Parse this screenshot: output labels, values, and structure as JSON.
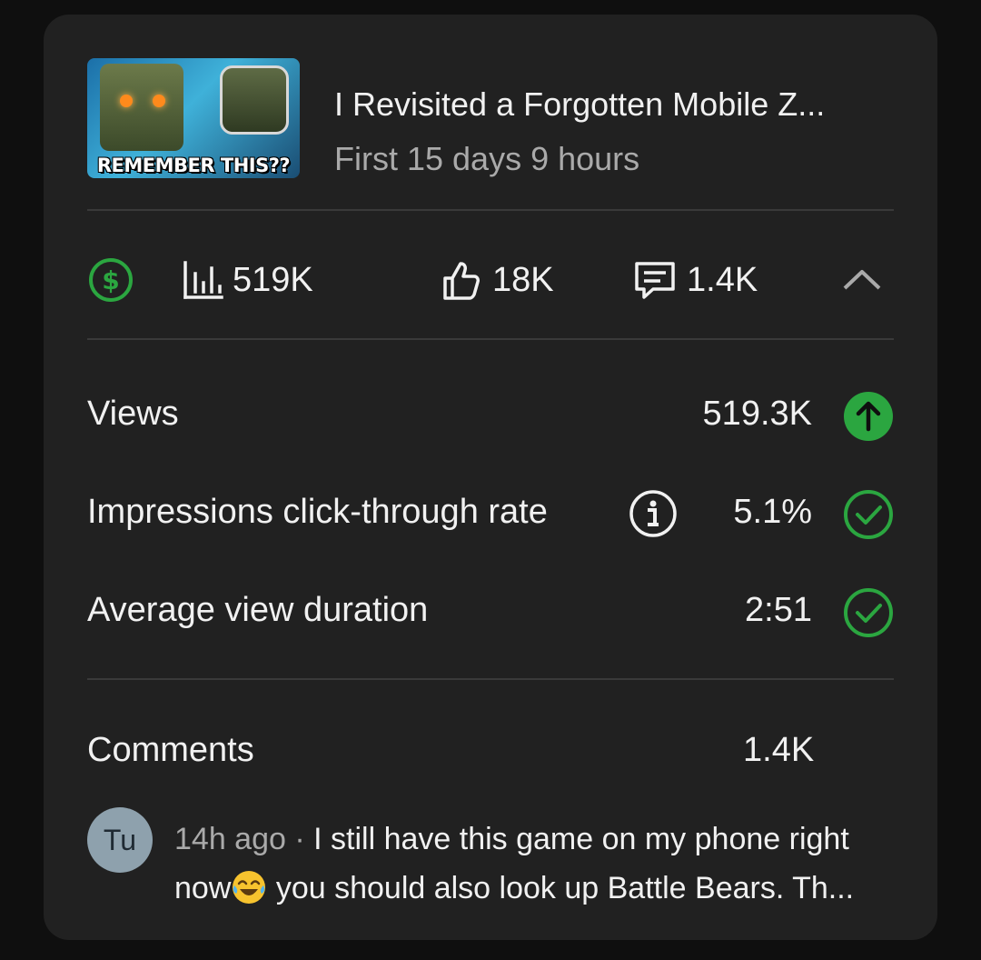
{
  "video": {
    "thumbnail_caption": "REMEMBER THIS??",
    "title": "I Revisited a Forgotten Mobile Z...",
    "subtitle": "First 15 days 9 hours"
  },
  "stats_bar": {
    "monetization_icon": "dollar-icon",
    "views": "519K",
    "likes": "18K",
    "comments": "1.4K",
    "collapse_icon": "chevron-up-icon"
  },
  "metrics": [
    {
      "label": "Views",
      "value": "519.3K",
      "status_icon": "arrow-up-circle-icon"
    },
    {
      "label": "Impressions click-through rate",
      "value": "5.1%",
      "status_icon": "check-circle-icon"
    },
    {
      "label": "Average view duration",
      "value": "2:51",
      "status_icon": "check-circle-icon"
    }
  ],
  "comments_section": {
    "label": "Comments",
    "count": "1.4K",
    "latest": {
      "avatar_initials": "Tu",
      "time": "14h ago",
      "separator": " · ",
      "text_part1": "I still have this game on my phone right now",
      "emoji": "😂",
      "text_part2": " you should also look up Battle Bears. Th..."
    }
  },
  "colors": {
    "card_bg": "#212121",
    "page_bg": "#0f0f0f",
    "accent_green": "#2ba640",
    "text_primary": "#f1f1f1",
    "text_secondary": "#aaaaaa"
  }
}
